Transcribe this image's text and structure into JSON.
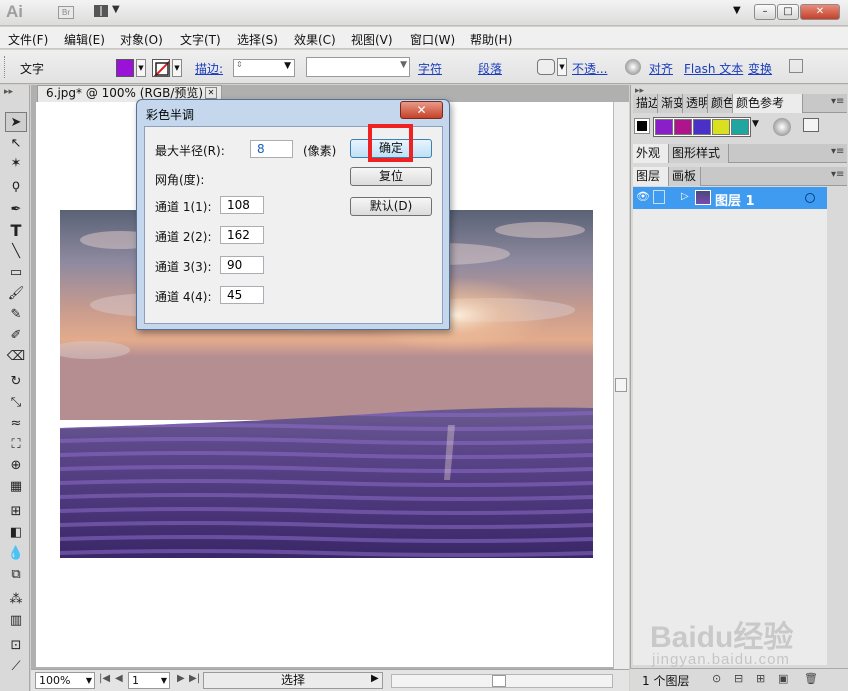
{
  "app": {
    "logo": "Ai",
    "bridge_logo": "Br",
    "window_buttons": {
      "minimize": "–",
      "restore": "□",
      "close": "✕"
    }
  },
  "menu": [
    "文件(F)",
    "编辑(E)",
    "对象(O)",
    "文字(T)",
    "选择(S)",
    "效果(C)",
    "视图(V)",
    "窗口(W)",
    "帮助(H)"
  ],
  "control_bar": {
    "selection_label": "文字",
    "fill_color": "#9a12d8",
    "stroke_label": "描边:",
    "character_link": "字符",
    "paragraph_link": "段落",
    "opacity_link": "不透...",
    "align_link": "对齐",
    "flash_text_link": "Flash 文本",
    "transform_link": "变换"
  },
  "document": {
    "tab_title": "6.jpg* @ 100% (RGB/预览)",
    "tab_close": "✕"
  },
  "status_bar": {
    "zoom": "100%",
    "artboard_number": "1",
    "tool_status": "选择"
  },
  "dialog": {
    "title": "彩色半调",
    "close": "✕",
    "max_radius_label": "最大半径(R):",
    "max_radius_value": "8",
    "unit_label": "(像素)",
    "screen_angles_label": "网角(度):",
    "channels": [
      {
        "label": "通道 1(1):",
        "value": "108"
      },
      {
        "label": "通道 2(2):",
        "value": "162"
      },
      {
        "label": "通道 3(3):",
        "value": "90"
      },
      {
        "label": "通道 4(4):",
        "value": "45"
      }
    ],
    "ok_button": "确定",
    "reset_button": "复位",
    "default_button": "默认(D)"
  },
  "right_panel": {
    "top_tabs": [
      "描边",
      "渐变",
      "透明",
      "颜色",
      "颜色参考"
    ],
    "guide_colors": [
      "#8a1ec8",
      "#b0148c",
      "#4b30c8",
      "#d8e020",
      "#20a6a0"
    ],
    "appearance_tabs": [
      "外观",
      "图形样式"
    ],
    "layers_tabs": [
      "图层",
      "画板"
    ],
    "layer_name": "图层 1",
    "layer_count": "1 个图层"
  },
  "watermark": {
    "text": "Baidu经验",
    "sub": "jingyan.baidu.com"
  }
}
